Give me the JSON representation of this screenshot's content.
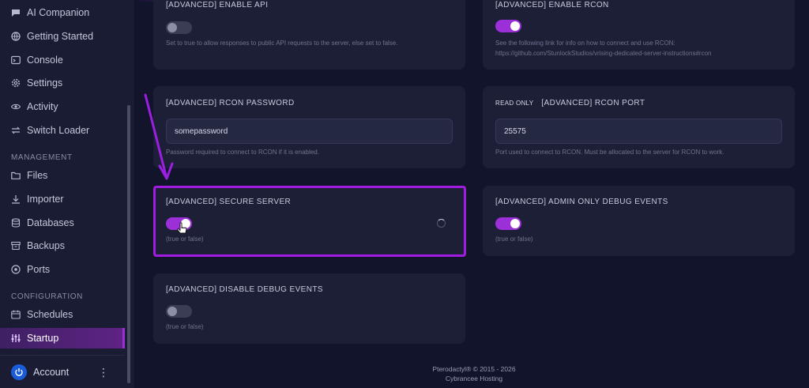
{
  "sidebar": {
    "items_top": [
      {
        "label": "AI Companion",
        "icon": "chat-icon"
      },
      {
        "label": "Getting Started",
        "icon": "globe-icon"
      },
      {
        "label": "Console",
        "icon": "terminal-icon"
      },
      {
        "label": "Settings",
        "icon": "gear-icon"
      },
      {
        "label": "Activity",
        "icon": "eye-icon"
      },
      {
        "label": "Switch Loader",
        "icon": "swap-icon"
      }
    ],
    "section_management": "MANAGEMENT",
    "items_management": [
      {
        "label": "Files",
        "icon": "folder-icon"
      },
      {
        "label": "Importer",
        "icon": "download-icon"
      },
      {
        "label": "Databases",
        "icon": "database-icon"
      },
      {
        "label": "Backups",
        "icon": "archive-icon"
      },
      {
        "label": "Ports",
        "icon": "network-icon"
      }
    ],
    "section_configuration": "CONFIGURATION",
    "items_configuration": [
      {
        "label": "Schedules",
        "icon": "calendar-icon"
      },
      {
        "label": "Startup",
        "icon": "sliders-icon",
        "active": true
      }
    ],
    "account_label": "Account"
  },
  "cards": {
    "enable_api": {
      "title": "[ADVANCED] ENABLE API",
      "description": "Set to true to allow responses to public API requests to the server, else set to false.",
      "toggle": false
    },
    "enable_rcon": {
      "title": "[ADVANCED] ENABLE RCON",
      "description_line1": "See the following link for info on how to connect and use RCON:",
      "description_line2": "https://github.com/StunlockStudios/vrising-dedicated-server-instructions#rcon",
      "toggle": true
    },
    "rcon_password": {
      "title": "[ADVANCED] RCON PASSWORD",
      "value": "somepassword",
      "description": "Password required to connect to RCON if it is enabled."
    },
    "rcon_port": {
      "badge": "READ ONLY",
      "title": "[ADVANCED] RCON PORT",
      "value": "25575",
      "description": "Port used to connect to RCON. Must be allocated to the server for RCON to work."
    },
    "secure_server": {
      "title": "[ADVANCED] SECURE SERVER",
      "description": "(true or false)",
      "toggle": true
    },
    "admin_debug": {
      "title": "[ADVANCED] ADMIN ONLY DEBUG EVENTS",
      "description": "(true or false)",
      "toggle": true
    },
    "disable_debug": {
      "title": "[ADVANCED] DISABLE DEBUG EVENTS",
      "description": "(true or false)",
      "toggle": false
    }
  },
  "footer": {
    "line1": "Pterodactyl® © 2015 - 2026",
    "line2": "Cybrancee Hosting"
  },
  "colors": {
    "accent": "#9b2fd8",
    "highlight_border": "#a21ce0",
    "background": "#12142b",
    "card": "#1c1f36"
  }
}
